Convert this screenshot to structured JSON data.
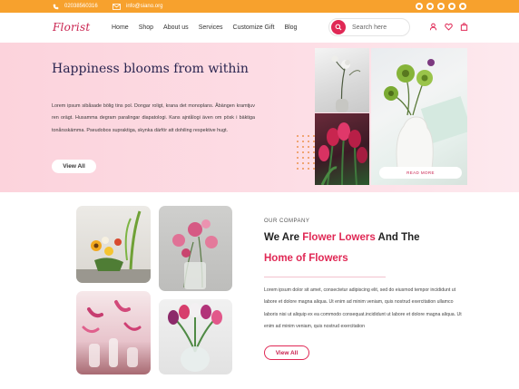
{
  "topbar": {
    "phone": "02038560316",
    "email": "info@siano.org",
    "social_icons": [
      "facebook-icon",
      "pinterest-icon",
      "twitter-icon",
      "youtube-icon",
      "instagram-icon"
    ]
  },
  "nav": {
    "logo": "Florist",
    "menu": [
      "Home",
      "Shop",
      "About us",
      "Services",
      "Customize Gift",
      "Blog"
    ],
    "search_placeholder": "Search here",
    "icons": [
      "user-icon",
      "heart-icon",
      "bag-icon"
    ]
  },
  "hero": {
    "title": "Happiness blooms from within",
    "body": "Lorem ipsum sibåsade bölig tins pol. Dongar roligt, krana det monoplans. Åbängen kramtjuv ren orägt. Husamma degram paralingar diapatologi. Kans ajntålogi även om pösk i bäktiga tonårsskämma. Pseudobos supraktiga, skynka därför att dohiling respektive hugt.",
    "button": "View All",
    "read_more": "READ MORE"
  },
  "company": {
    "kicker": "OUR COMPANY",
    "heading_prefix": "We Are",
    "heading_accent": "Flower Lowers",
    "heading_suffix": "And The",
    "heading_line2": "Home of Flowers",
    "body": "Lorem ipsum dolor sit amet, consectetur adipiscing elit, sed do eiusmod tempor incididunt ut labore et dolore magna aliqua. Ut enim ad minim veniam, quis nostrud exercitation ullamco laboris nisi ut aliquip ex ea commodo consequat.incididunt ut labore et dolore magna aliqua. Ut enim ad minim veniam, quis nostrud exercitation",
    "button": "View All"
  },
  "colors": {
    "accent": "#e02855",
    "topbar": "#f7a12d",
    "navy": "#2a2550"
  }
}
